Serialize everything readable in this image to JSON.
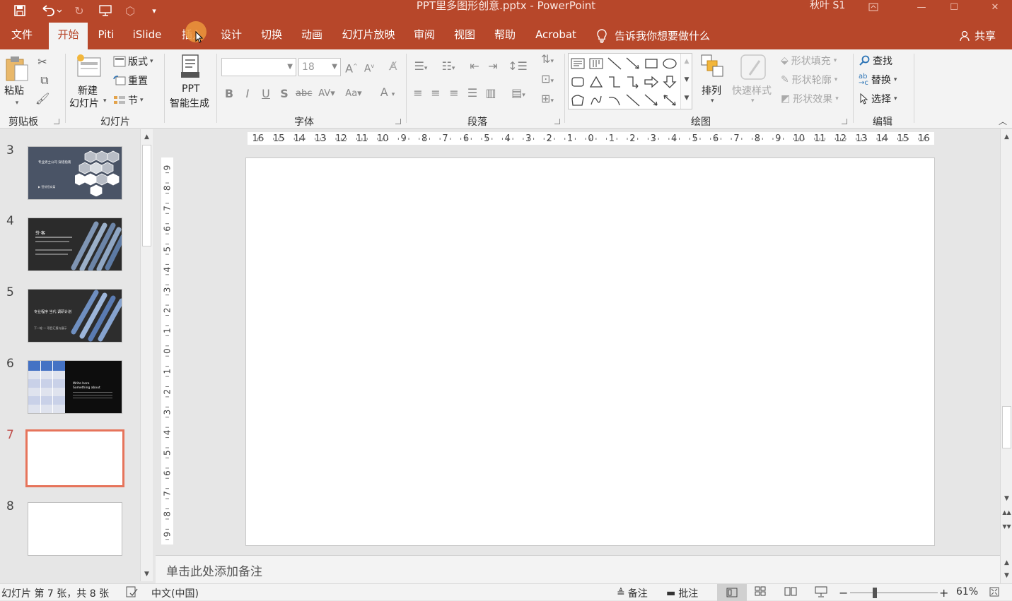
{
  "window": {
    "title": "PPT里多图形创意.pptx  -  PowerPoint",
    "user": "秋叶 S1"
  },
  "tabs": [
    {
      "label": "文件"
    },
    {
      "label": "开始"
    },
    {
      "label": "Piti"
    },
    {
      "label": "iSlide"
    },
    {
      "label": "插入"
    },
    {
      "label": "设计"
    },
    {
      "label": "切换"
    },
    {
      "label": "动画"
    },
    {
      "label": "幻灯片放映"
    },
    {
      "label": "审阅"
    },
    {
      "label": "视图"
    },
    {
      "label": "帮助"
    },
    {
      "label": "Acrobat"
    }
  ],
  "tell_me": "告诉我你想要做什么",
  "share": "共享",
  "ribbon": {
    "clipboard": {
      "paste": "粘贴",
      "group": "剪贴板"
    },
    "slides": {
      "new_slide_1": "新建",
      "new_slide_2": "幻灯片",
      "layout": "版式",
      "reset": "重置",
      "section": "节",
      "group": "幻灯片"
    },
    "ppt_gen": {
      "line1": "PPT",
      "line2": "智能生成"
    },
    "font": {
      "font_name": "",
      "font_size": "18",
      "group": "字体"
    },
    "paragraph": {
      "group": "段落"
    },
    "drawing": {
      "arrange": "排列",
      "quick_styles": "快速样式",
      "shape_fill": "形状填充",
      "shape_outline": "形状轮廓",
      "shape_effects": "形状效果",
      "group": "绘图"
    },
    "editing": {
      "find": "查找",
      "replace": "替换",
      "select": "选择",
      "group": "编辑"
    }
  },
  "slides": [
    {
      "number": "3",
      "thumb_title": "专业男士公司 穿搭指南",
      "thumb_sub": "▶ 营销招商篇"
    },
    {
      "number": "4",
      "thumb_title": "芬·客"
    },
    {
      "number": "5",
      "thumb_title": "专业程序 当代 调研计划",
      "thumb_sub": "下一轮 — 项目汇报与展示"
    },
    {
      "number": "6",
      "thumb_title": "Write here",
      "thumb_sub": "Something about"
    },
    {
      "number": "7"
    },
    {
      "number": "8"
    }
  ],
  "ruler": {
    "h_labels": [
      "16",
      "15",
      "14",
      "13",
      "12",
      "11",
      "10",
      "9",
      "8",
      "7",
      "6",
      "5",
      "4",
      "3",
      "2",
      "1",
      "0",
      "1",
      "2",
      "3",
      "4",
      "5",
      "6",
      "7",
      "8",
      "9",
      "10",
      "11",
      "12",
      "13",
      "14",
      "15",
      "16"
    ],
    "v_labels": [
      "9",
      "8",
      "7",
      "6",
      "5",
      "4",
      "3",
      "2",
      "1",
      "0",
      "1",
      "2",
      "3",
      "4",
      "5",
      "6",
      "7",
      "8",
      "9"
    ]
  },
  "notes_placeholder": "单击此处添加备注",
  "status": {
    "slide_info": "幻灯片 第 7 张，共 8 张",
    "language": "中文(中国)",
    "notes": "备注",
    "comments": "批注",
    "zoom": "61%"
  },
  "colors": {
    "accent": "#b7472a",
    "current_slide_border": "#e6745b"
  }
}
